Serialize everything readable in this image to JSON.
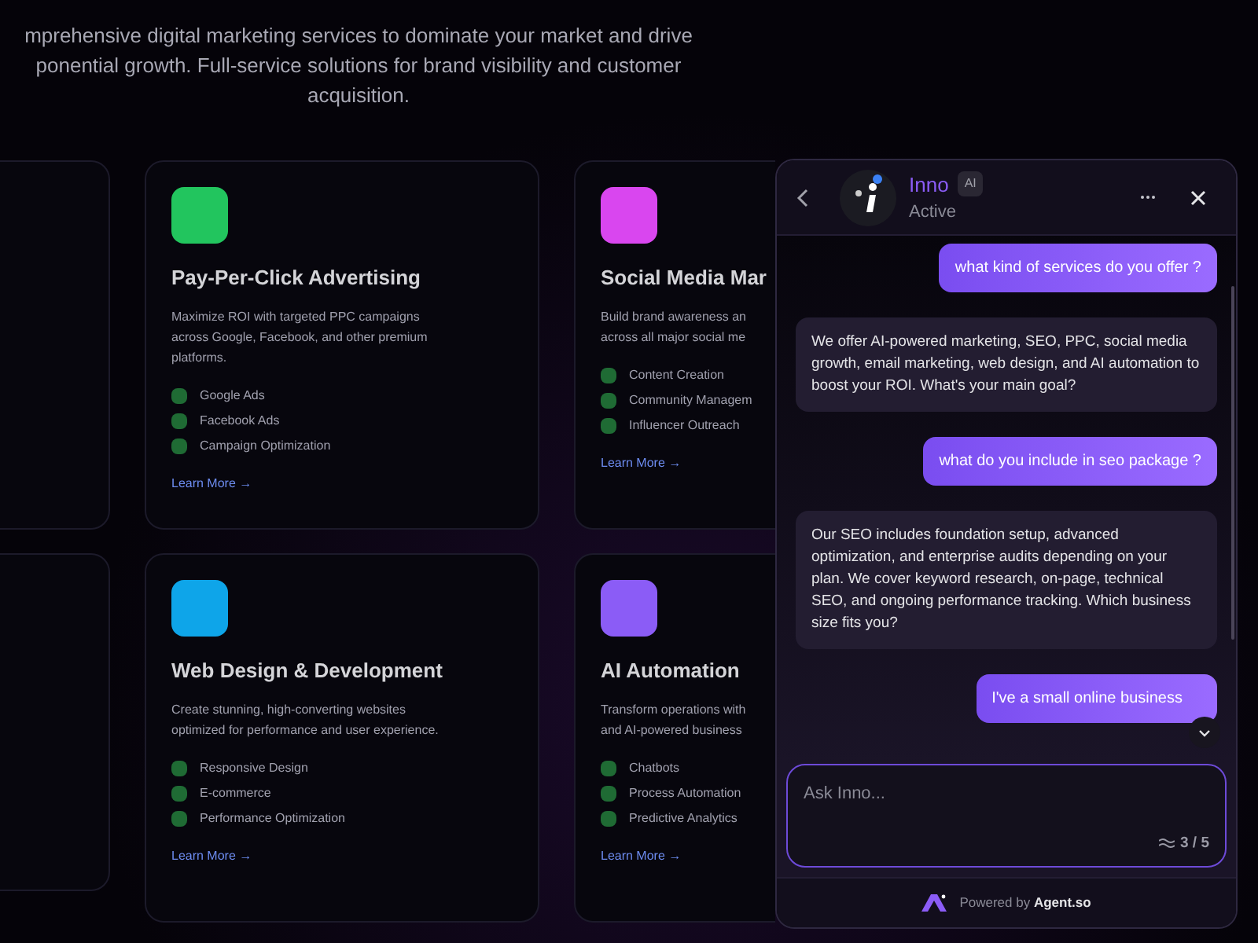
{
  "intro": [
    "mprehensive digital marketing services to dominate your market and drive",
    "ponential growth. Full-service solutions for brand visibility and customer",
    "acquisition."
  ],
  "cards": [
    {
      "color": "#22c55e",
      "title": "Pay-Per-Click Advertising",
      "description": [
        "Maximize ROI with targeted PPC campaigns",
        "across Google, Facebook, and other premium",
        "platforms."
      ],
      "features": [
        "Google Ads",
        "Facebook Ads",
        "Campaign Optimization"
      ],
      "link": "Learn More →"
    },
    {
      "color": "#d946ef",
      "title": "Social Media Mar",
      "description": [
        "Build brand awareness an",
        "across all major social me"
      ],
      "features": [
        "Content Creation",
        "Community Managem",
        "Influencer Outreach"
      ],
      "link": "Learn More →"
    },
    {
      "color": "#0ea5e9",
      "title": "Web Design & Development",
      "description": [
        "Create stunning, high-converting websites",
        "optimized for performance and user experience."
      ],
      "features": [
        "Responsive Design",
        "E-commerce",
        "Performance Optimization"
      ],
      "link": "Learn More →"
    },
    {
      "color": "#8b5cf6",
      "title": "AI Automation",
      "description": [
        "Transform operations with",
        "and AI-powered business"
      ],
      "features": [
        "Chatbots",
        "Process Automation",
        "Predictive Analytics"
      ],
      "link": "Learn More →"
    }
  ],
  "chat": {
    "name": "Inno",
    "badge": "AI",
    "status": "Active",
    "online": true,
    "messages": [
      {
        "kind": "user",
        "text": "what kind of services do you offer ?"
      },
      {
        "kind": "bot",
        "text": "We offer AI-powered marketing, SEO, PPC, social media growth, email marketing, web design, and AI automation to boost your ROI. What's your main goal?"
      },
      {
        "kind": "user",
        "text": "what do you include in seo package ?"
      },
      {
        "kind": "bot",
        "text": "Our SEO includes foundation setup, advanced optimization, and enterprise audits depending on your plan. We cover keyword research, on-page, technical SEO, and ongoing performance tracking. Which business size fits you?"
      },
      {
        "kind": "user",
        "text": "I've a small online business"
      }
    ],
    "input": {
      "placeholder": "Ask Inno..."
    },
    "counter": "3 / 5",
    "footer": "Powered by **Agent.so**"
  }
}
